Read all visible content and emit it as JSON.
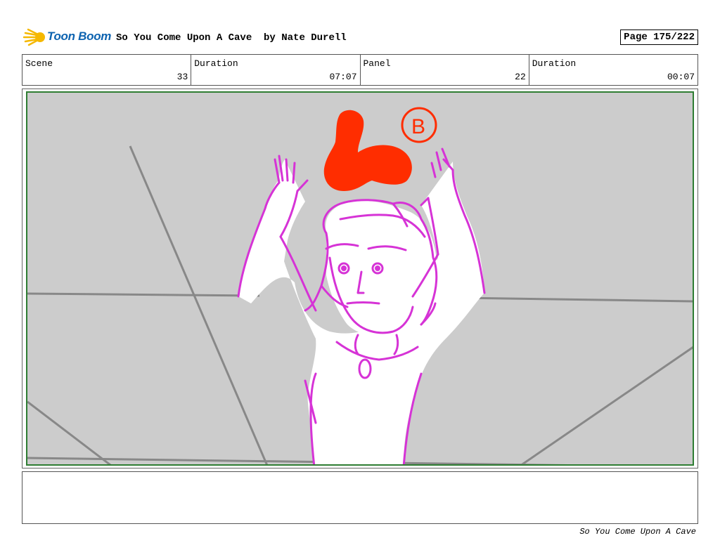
{
  "header": {
    "logo_text": "Toon Boom",
    "title": "So You Come Upon A Cave  by Nate Durell",
    "page": "Page 175/222"
  },
  "info": [
    {
      "label": "Scene",
      "value": "33"
    },
    {
      "label": "Duration",
      "value": "07:07"
    },
    {
      "label": "Panel",
      "value": "22"
    },
    {
      "label": "Duration",
      "value": "00:07"
    }
  ],
  "panel": {
    "annotation_mark": "B",
    "colors": {
      "background": "#cccccc",
      "frame": "#2e7d32",
      "character": "#d633d6",
      "butterfly": "#ff2d00",
      "perspective_lines": "#888888"
    }
  },
  "footer": {
    "text": "So You Come Upon A Cave"
  }
}
